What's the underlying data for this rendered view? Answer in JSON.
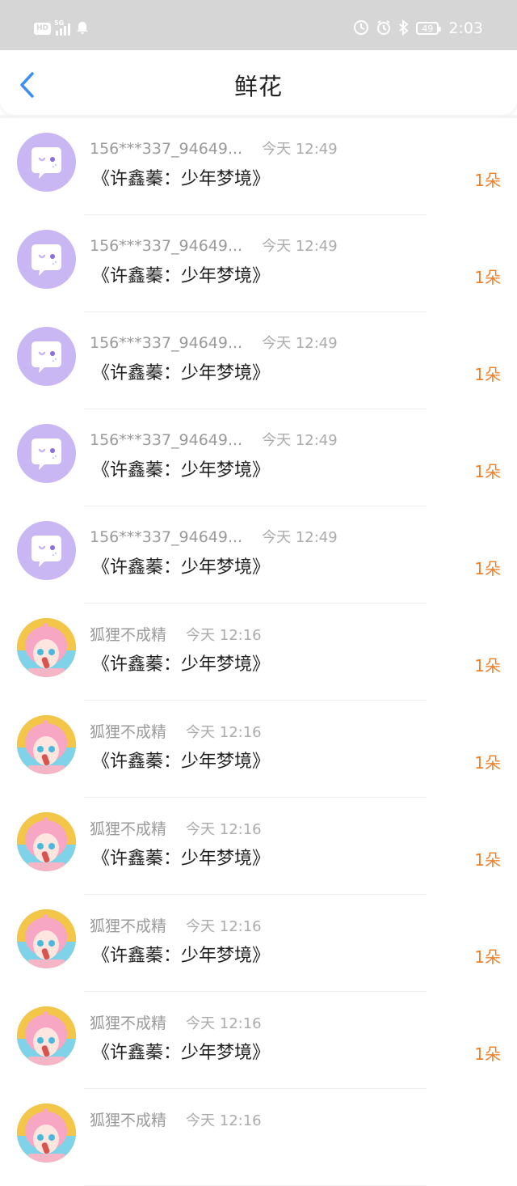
{
  "status_bar": {
    "hd": "HD",
    "network": "5G",
    "battery": "49",
    "time": "2:03"
  },
  "header": {
    "title": "鲜花"
  },
  "colors": {
    "accent_blue": "#3d8ef7",
    "count_orange": "#f07f2d",
    "default_avatar": "#c9b7f3"
  },
  "items": [
    {
      "name": "156***337_94649...",
      "time": "今天 12:49",
      "book": "《许鑫蓁：少年梦境》",
      "count": "1朵",
      "avatar": "default-chat-avatar-icon"
    },
    {
      "name": "156***337_94649...",
      "time": "今天 12:49",
      "book": "《许鑫蓁：少年梦境》",
      "count": "1朵",
      "avatar": "default-chat-avatar-icon"
    },
    {
      "name": "156***337_94649...",
      "time": "今天 12:49",
      "book": "《许鑫蓁：少年梦境》",
      "count": "1朵",
      "avatar": "default-chat-avatar-icon"
    },
    {
      "name": "156***337_94649...",
      "time": "今天 12:49",
      "book": "《许鑫蓁：少年梦境》",
      "count": "1朵",
      "avatar": "default-chat-avatar-icon"
    },
    {
      "name": "156***337_94649...",
      "time": "今天 12:49",
      "book": "《许鑫蓁：少年梦境》",
      "count": "1朵",
      "avatar": "default-chat-avatar-icon"
    },
    {
      "name": "狐狸不成精",
      "time": "今天 12:16",
      "book": "《许鑫蓁：少年梦境》",
      "count": "1朵",
      "avatar": "anime-girl-avatar"
    },
    {
      "name": "狐狸不成精",
      "time": "今天 12:16",
      "book": "《许鑫蓁：少年梦境》",
      "count": "1朵",
      "avatar": "anime-girl-avatar"
    },
    {
      "name": "狐狸不成精",
      "time": "今天 12:16",
      "book": "《许鑫蓁：少年梦境》",
      "count": "1朵",
      "avatar": "anime-girl-avatar"
    },
    {
      "name": "狐狸不成精",
      "time": "今天 12:16",
      "book": "《许鑫蓁：少年梦境》",
      "count": "1朵",
      "avatar": "anime-girl-avatar"
    },
    {
      "name": "狐狸不成精",
      "time": "今天 12:16",
      "book": "《许鑫蓁：少年梦境》",
      "count": "1朵",
      "avatar": "anime-girl-avatar"
    },
    {
      "name": "狐狸不成精",
      "time": "今天 12:16",
      "book": "",
      "count": "",
      "avatar": "anime-girl-avatar"
    }
  ]
}
